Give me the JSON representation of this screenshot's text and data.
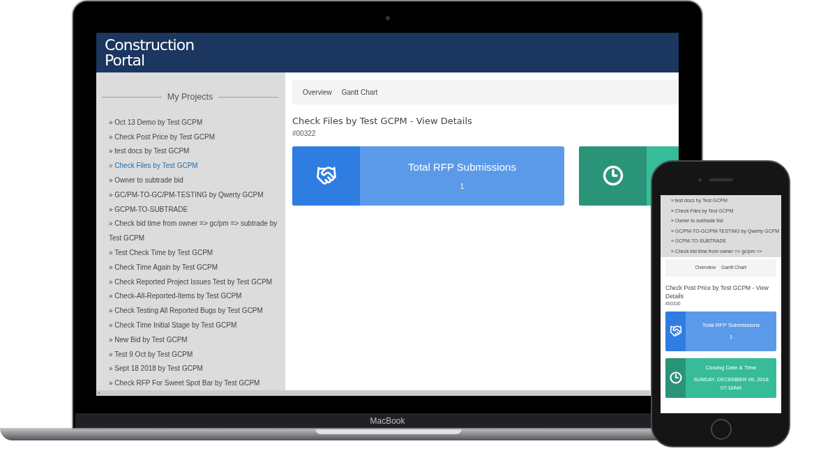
{
  "laptop": {
    "brand": "Construction Portal",
    "device_label": "MacBook",
    "sidebar": {
      "heading": "My Projects",
      "items": [
        {
          "label": "» Oct 13 Demo by Test GCPM",
          "selected": false
        },
        {
          "label": "» Check Post Price by Test GCPM",
          "selected": false
        },
        {
          "label": "» test docs by Test GCPM",
          "selected": false
        },
        {
          "label": "» Check Files by Test GCPM",
          "selected": true
        },
        {
          "label": "» Owner to subtrade bid",
          "selected": false
        },
        {
          "label": "» GC/PM-TO-GC/PM-TESTING by Qwerty GCPM",
          "selected": false
        },
        {
          "label": "» GCPM-TO-SUBTRADE",
          "selected": false
        },
        {
          "label": "» Check bid time from owner => gc/pm => subtrade by Test GCPM",
          "selected": false
        },
        {
          "label": "» Test Check Time by Test GCPM",
          "selected": false
        },
        {
          "label": "» Check Time Again by Test GCPM",
          "selected": false
        },
        {
          "label": "» Check Reported Project Issues Test by Test GCPM",
          "selected": false
        },
        {
          "label": "» Check-All-Reported-Items by Test GCPM",
          "selected": false
        },
        {
          "label": "» Check Testing All Reported Bugs by Test GCPM",
          "selected": false
        },
        {
          "label": "» Check Time Initial Stage by Test GCPM",
          "selected": false
        },
        {
          "label": "» New Bid by Test GCPM",
          "selected": false
        },
        {
          "label": "» Test 9 Oct by Test GCPM",
          "selected": false
        },
        {
          "label": "» Sept 18 2018 by Test GCPM",
          "selected": false
        },
        {
          "label": "» Check RFP For Sweet Spot Bar by Test GCPM",
          "selected": false
        }
      ]
    },
    "tabs": [
      "Overview",
      "Gantt Chart"
    ],
    "title": "Check Files by Test GCPM - View Details",
    "project_id": "#00322",
    "cards": [
      {
        "kind": "handshake",
        "title": "Total RFP Submissions",
        "value": "1"
      },
      {
        "kind": "clock"
      }
    ]
  },
  "phone": {
    "sidebar_items": [
      {
        "label": "» test docs by Test GCPM"
      },
      {
        "label": "» Check Files by Test GCPM"
      },
      {
        "label": "» Owner to subtrade bid"
      },
      {
        "label": "» GC/PM-TO-GC/PM-TESTING by Qwerty GCPM"
      },
      {
        "label": "» GCPM-TO-SUBTRADE"
      },
      {
        "label": "» Check bid time from owner => gc/pm =>"
      }
    ],
    "tabs": [
      "Overview",
      "Gantt Chart"
    ],
    "title": "Check Post Price by Test GCPM - View Details",
    "project_id": "#00330",
    "cards": [
      {
        "kind": "handshake",
        "title": "Total RFP Submissions",
        "value": "1"
      },
      {
        "kind": "clock",
        "title": "Closing Date & Time",
        "value": "SUNDAY, DECEMBER 09, 2018 07:10AM"
      }
    ]
  }
}
